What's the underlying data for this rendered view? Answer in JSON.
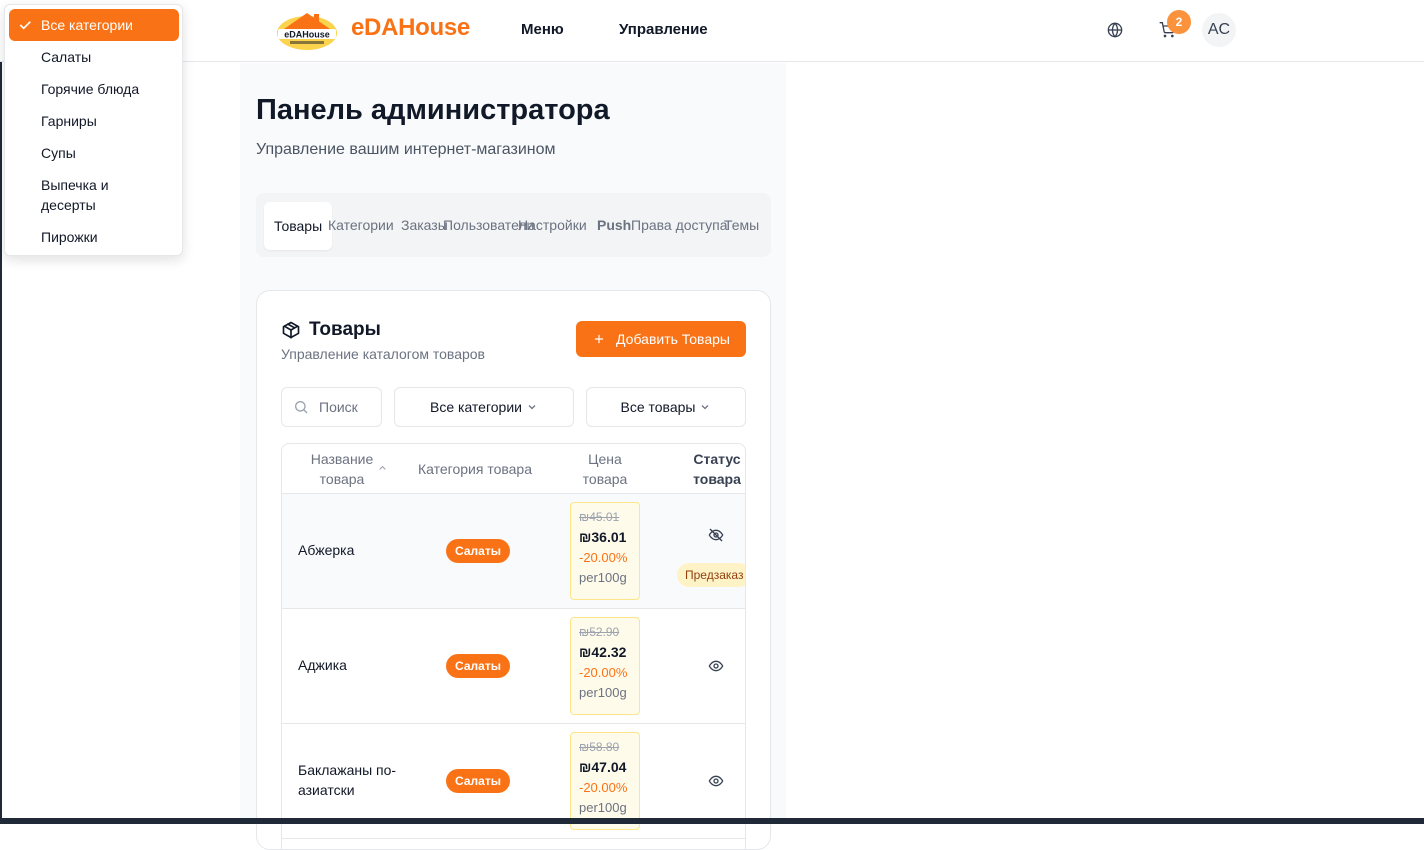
{
  "header": {
    "brand": "eDAHouse",
    "logo_text": "eDAHouse",
    "nav": [
      {
        "label": "Меню"
      },
      {
        "label": "Управление"
      }
    ],
    "cart_count": "2",
    "avatar_initials": "AC"
  },
  "page": {
    "title": "Панель администратора",
    "subtitle": "Управление вашим интернет-магазином"
  },
  "tabs": [
    {
      "label": "Товары",
      "active": true
    },
    {
      "label": "Категории"
    },
    {
      "label": "Заказы"
    },
    {
      "label": "Пользователи"
    },
    {
      "label": "Настройки"
    },
    {
      "label": "Push"
    },
    {
      "label": "Права доступа"
    },
    {
      "label": "Темы"
    }
  ],
  "products_card": {
    "title": "Товары",
    "subtitle": "Управление каталогом товаров",
    "add_button": "Добавить Товары",
    "search_placeholder": "Поиск",
    "category_filter": "Все категории",
    "status_filter": "Все товары",
    "columns": {
      "name": "Название товара",
      "category": "Категория товара",
      "price": "Цена товара",
      "status": "Статус товара"
    },
    "rows": [
      {
        "name": "Абжерка",
        "category": "Салаты",
        "old_price": "₪45.01",
        "price": "₪36.01",
        "discount": "-20.00%",
        "unit": "per100g",
        "visibility": "hidden",
        "badge": "Предзаказ"
      },
      {
        "name": "Аджика",
        "category": "Салаты",
        "old_price": "₪52.90",
        "price": "₪42.32",
        "discount": "-20.00%",
        "unit": "per100g",
        "visibility": "visible"
      },
      {
        "name": "Баклажаны по-азиатски",
        "category": "Салаты",
        "old_price": "₪58.80",
        "price": "₪47.04",
        "discount": "-20.00%",
        "unit": "per100g",
        "visibility": "visible"
      }
    ]
  },
  "category_dropdown": {
    "items": [
      {
        "label": "Все категории",
        "selected": true
      },
      {
        "label": "Салаты"
      },
      {
        "label": "Горячие блюда"
      },
      {
        "label": "Гарниры"
      },
      {
        "label": "Супы"
      },
      {
        "label": "Выпечка и десерты"
      },
      {
        "label": "Пирожки"
      }
    ]
  },
  "colors": {
    "accent": "#f97316",
    "badge_bg": "#fb923c",
    "price_bg": "#fffbeb",
    "preorder_bg": "#fef3c7"
  }
}
